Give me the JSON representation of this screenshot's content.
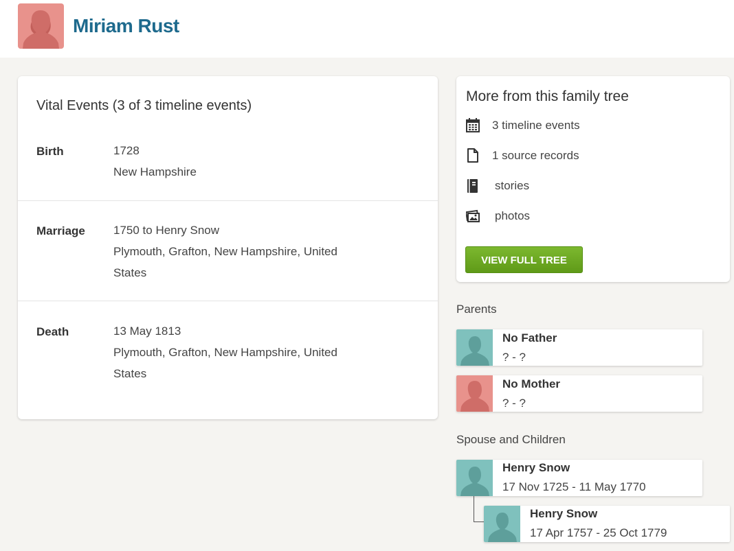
{
  "person": {
    "name": "Miriam Rust",
    "avatar_icon": "female-silhouette-icon"
  },
  "vital_events": {
    "title": "Vital Events (3 of 3 timeline events)",
    "events": [
      {
        "type": "Birth",
        "line1": "1728",
        "line2": "New Hampshire",
        "line3": ""
      },
      {
        "type": "Marriage",
        "line1": "1750 to Henry Snow",
        "line2": "Plymouth, Grafton, New Hampshire, United",
        "line3": "States"
      },
      {
        "type": "Death",
        "line1": "13 May 1813",
        "line2": "Plymouth, Grafton, New Hampshire, United",
        "line3": "States"
      }
    ]
  },
  "more": {
    "title": "More from this family tree",
    "items": [
      {
        "icon": "calendar-icon",
        "label": "3 timeline events"
      },
      {
        "icon": "document-icon",
        "label": "1 source records"
      },
      {
        "icon": "book-icon",
        "label": "stories"
      },
      {
        "icon": "photos-icon",
        "label": "photos"
      }
    ],
    "button_label": "VIEW FULL TREE",
    "button_color": "#6cab1e"
  },
  "parents": {
    "label": "Parents",
    "father": {
      "name": "No Father",
      "dates": "? - ?",
      "gender": "male"
    },
    "mother": {
      "name": "No Mother",
      "dates": "? - ?",
      "gender": "female"
    }
  },
  "spouse_children": {
    "label": "Spouse and Children",
    "spouse": {
      "name": "Henry Snow",
      "dates": "17 Nov 1725 - 11 May 1770",
      "gender": "male"
    },
    "child": {
      "name": "Henry Snow",
      "dates": "17 Apr 1757 - 25 Oct 1779",
      "gender": "male"
    }
  },
  "colors": {
    "name_link": "#1e6a8d",
    "female_avatar": "#e8928c",
    "male_avatar": "#7fc1bd",
    "page_bg": "#f5f4f1"
  }
}
